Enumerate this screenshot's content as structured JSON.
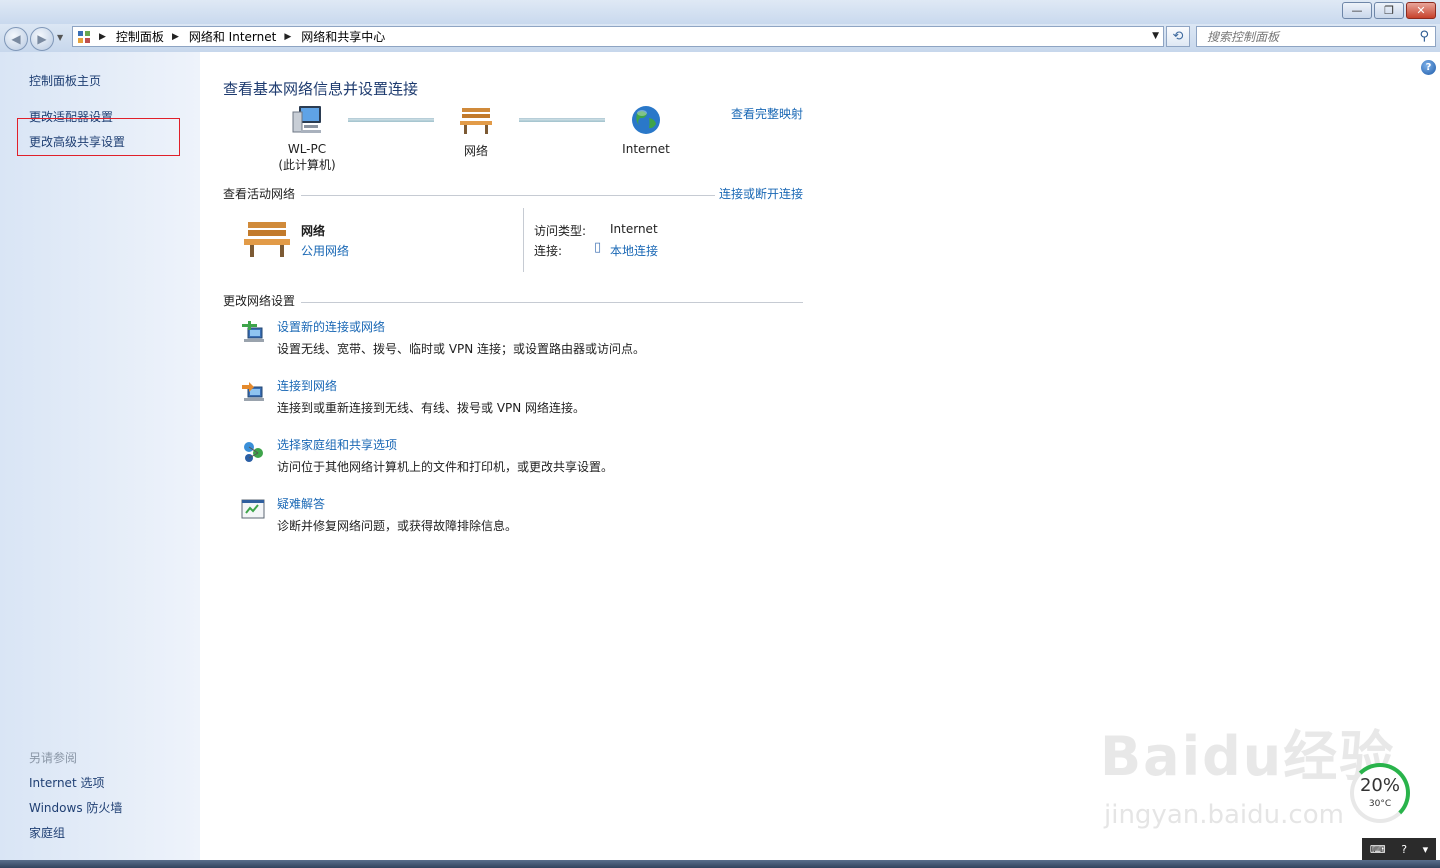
{
  "window": {
    "minimize_glyph": "—",
    "restore_glyph": "❐",
    "close_glyph": "✕"
  },
  "nav": {
    "back_glyph": "◀",
    "forward_glyph": "▶",
    "breadcrumb": [
      "控制面板",
      "网络和 Internet",
      "网络和共享中心"
    ],
    "search_placeholder": "搜索控制面板"
  },
  "sidebar": {
    "home": "控制面板主页",
    "change_adapter": "更改适配器设置",
    "change_sharing": "更改高级共享设置",
    "see_also_title": "另请参阅",
    "see_also": [
      "Internet 选项",
      "Windows 防火墙",
      "家庭组"
    ]
  },
  "main": {
    "title": "查看基本网络信息并设置连接",
    "view_full_map": "查看完整映射",
    "map": {
      "computer_name": "WL-PC",
      "computer_sub": "(此计算机)",
      "network": "网络",
      "internet": "Internet"
    },
    "active_networks": {
      "heading": "查看活动网络",
      "connect_disconnect": "连接或断开连接",
      "network_name": "网络",
      "network_type": "公用网络",
      "access_type_label": "访问类型:",
      "access_type_value": "Internet",
      "connections_label": "连接:",
      "connections_value": "本地连接"
    },
    "change_settings": {
      "heading": "更改网络设置",
      "tasks": [
        {
          "title": "设置新的连接或网络",
          "desc": "设置无线、宽带、拨号、临时或 VPN 连接；或设置路由器或访问点。"
        },
        {
          "title": "连接到网络",
          "desc": "连接到或重新连接到无线、有线、拨号或 VPN 网络连接。"
        },
        {
          "title": "选择家庭组和共享选项",
          "desc": "访问位于其他网络计算机上的文件和打印机，或更改共享设置。"
        },
        {
          "title": "疑难解答",
          "desc": "诊断并修复网络问题，或获得故障排除信息。"
        }
      ]
    }
  },
  "overlay": {
    "watermark": "Baidu经验",
    "watermark_url": "jingyan.baidu.com",
    "gauge_percent": "20%",
    "gauge_temp": "30°C"
  },
  "colors": {
    "link": "#1a68b5",
    "heading": "#1e3b6f",
    "sidebar_bg": "#dfe8f6",
    "highlight_box": "#e0202a"
  }
}
